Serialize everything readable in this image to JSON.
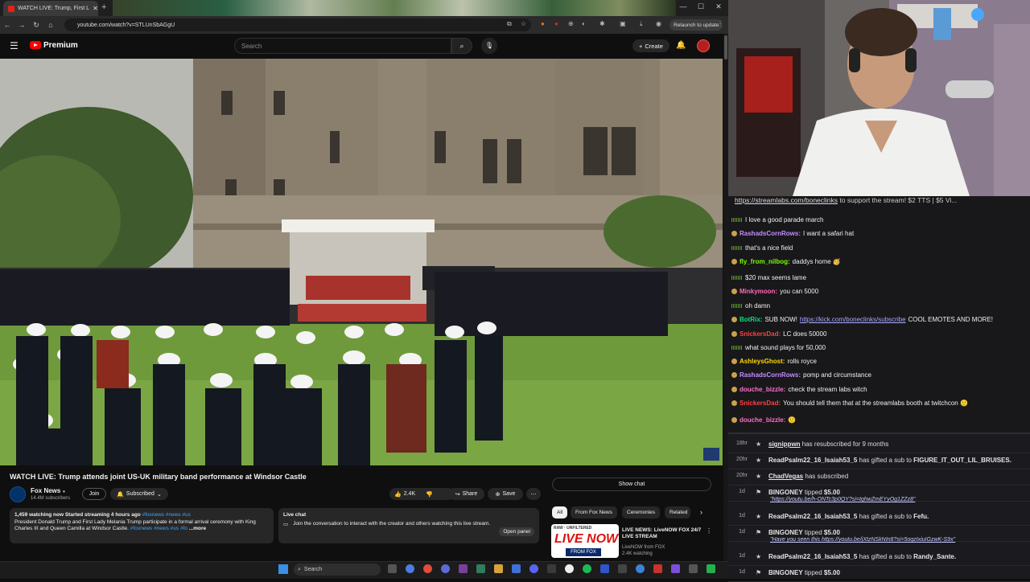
{
  "browser": {
    "tab_title": "WATCH LIVE: Trump, First L",
    "url": "youtube.com/watch?v=STLUnSbAGgU",
    "relaunch_label": "Relaunch to update"
  },
  "youtube": {
    "brand": "Premium",
    "search_placeholder": "Search",
    "create_label": "Create",
    "video_watermark": "FOX NEWS"
  },
  "video_info": {
    "title": "WATCH LIVE: Trump attends joint US-UK military band performance at Windsor Castle",
    "channel": "Fox News",
    "subscribers": "14.4M subscribers",
    "join_label": "Join",
    "subscribed_label": "Subscribed",
    "likes": "2.4K",
    "share_label": "Share",
    "save_label": "Save",
    "desc_stats": "1,459 watching now  Started streaming 4 hours ago",
    "desc_tags": "#foxnews #news #us",
    "desc_text": "President Donald Trump and First Lady Melania Trump participate in a formal arrival ceremony with King Charles III and Queen Camilla at Windsor Castle.",
    "desc_tags2": "#foxnews #news #us #fo",
    "more_label": "...more",
    "live_chat_title": "Live chat",
    "live_chat_text": "Join the conversation to interact with the creator and others watching this live stream.",
    "open_panel": "Open panel"
  },
  "sidebar": {
    "show_chat": "Show chat",
    "chips": [
      "All",
      "From Fox News",
      "Ceremonies",
      "Related"
    ],
    "rec_title": "LIVE NEWS: LiveNOW FOX 24/7 LIVE STREAM",
    "rec_channel": "LiveNOW from FOX",
    "rec_views": "2.4K watching",
    "thumb_top": "RAW · UNFILTERED",
    "thumb_main": "LIVE NOW",
    "thumb_sub": "FROM FOX"
  },
  "taskbar": {
    "search_label": "Search"
  },
  "stream_chat": {
    "banner_link": "https://streamlabs.com/boneclinks",
    "banner_text": " to support the stream! $2 TTS | $5 Vi...",
    "messages": [
      {
        "user": "",
        "user_color": "#ffffff",
        "text": "I love a good parade march"
      },
      {
        "user": "RashadsCornRows:",
        "user_color": "#c58cff",
        "text": " I want a safari hat"
      },
      {
        "user": "",
        "user_color": "#ffffff",
        "text": "that's a nice field"
      },
      {
        "user": "fly_from_nilbog:",
        "user_color": "#7cfc00",
        "text": " daddys home 🥳"
      },
      {
        "user": "",
        "user_color": "#ffffff",
        "text": "$20 max seems lame"
      },
      {
        "user": "Minkymoon:",
        "user_color": "#ff69b4",
        "text": " you can 5000"
      },
      {
        "user": "",
        "user_color": "#ffffff",
        "text": "oh damn"
      },
      {
        "user": "BotRix:",
        "user_color": "#00e676",
        "text": " SUB NOW! ",
        "link": "https://kick.com/boneclinks/subscribe",
        "after": " COOL EMOTES AND MORE!"
      },
      {
        "user": "SnickersDad:",
        "user_color": "#ff4040",
        "text": " LC does 50000"
      },
      {
        "user": "",
        "user_color": "#ffffff",
        "text": "what sound plays for 50,000"
      },
      {
        "user": "AshleysGhost:",
        "user_color": "#ffd700",
        "text": " rolls royce"
      },
      {
        "user": "RashadsCornRows:",
        "user_color": "#c58cff",
        "text": " pomp and circumstance"
      },
      {
        "user": "douche_bizzle:",
        "user_color": "#ff6ec7",
        "text": " check the stream labs witch"
      },
      {
        "user": "SnickersDad:",
        "user_color": "#ff4040",
        "text": " You should tell them that at the streamlabs booth at twitchcon 🙂"
      },
      {
        "user": "douche_bizzle:",
        "user_color": "#ff6ec7",
        "text": " 🙂"
      }
    ]
  },
  "events": [
    {
      "time": "18hr",
      "user": "signippwn",
      "text": " has resubscribed for 9 months",
      "sub": ""
    },
    {
      "time": "20hr",
      "user": "ReadPsalm22_16_Isaiah53_5",
      "text": " has gifted a sub to ",
      "target": "FIGURE_IT_OUT_LIL_BRUISES.",
      "sub": ""
    },
    {
      "time": "20hr",
      "user": "ChadVegas",
      "text": " has subscribed",
      "sub": ""
    },
    {
      "time": "1d",
      "user": "BINGONEY",
      "text": " tipped ",
      "amount": "$5.00",
      "sub": "\"https://youtu.be/h-ONTc3p0QY?si=tqhwZmEYyOg1ZZz8\""
    },
    {
      "time": "1d",
      "user": "ReadPsalm22_16_Isaiah53_5",
      "text": " has gifted a sub to ",
      "target": "Fefu.",
      "sub": ""
    },
    {
      "time": "1d",
      "user": "BINGONEY",
      "text": " tipped ",
      "amount": "$5.00",
      "sub": "\"Have you seen this https://youtu.be/jXtzNSkNIn8?si=5oqzIxiuIGzwK-S9x\""
    },
    {
      "time": "1d",
      "user": "ReadPsalm22_16_Isaiah53_5",
      "text": " has gifted a sub to ",
      "target": "Randy_Sante.",
      "sub": ""
    },
    {
      "time": "1d",
      "user": "BINGONEY",
      "text": " tipped ",
      "amount": "$5.00",
      "sub": ""
    }
  ]
}
